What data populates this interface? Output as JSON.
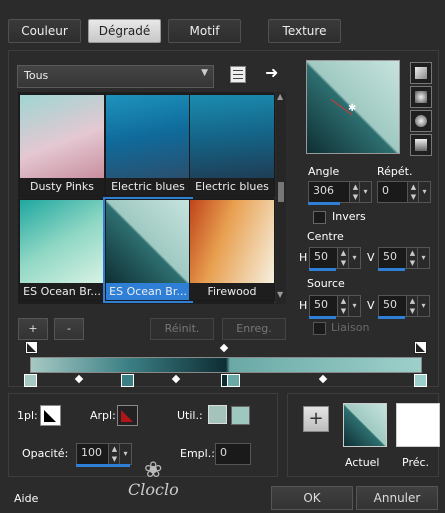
{
  "tabs": [
    {
      "label": "Couleur",
      "active": false
    },
    {
      "label": "Dégradé",
      "active": true
    },
    {
      "label": "Motif",
      "active": false
    },
    {
      "label": "Texture",
      "active": false
    }
  ],
  "category_dropdown": {
    "value": "Tous"
  },
  "gradients": [
    {
      "label": "Dusty Pinks",
      "colors": [
        "#9ed6d2",
        "#e4c8d2",
        "#c98f9f"
      ]
    },
    {
      "label": "Electric blues",
      "colors": [
        "#1e93bd",
        "#0f6a9a",
        "#2b4f6e"
      ]
    },
    {
      "label": "Electric blues",
      "colors": [
        "#1b8cb0",
        "#146487",
        "#1f3d55"
      ]
    },
    {
      "label": "ES Ocean Br...",
      "colors": [
        "#1fa7a0",
        "#8fd7c4",
        "#d8f2e4"
      ]
    },
    {
      "label": "ES Ocean Br...",
      "colors": [
        "#9fc9c2",
        "#2e6f70",
        "#0e2f34"
      ],
      "selected": true
    },
    {
      "label": "Firewood",
      "colors": [
        "#c0441a",
        "#e8a050",
        "#f6f0e0"
      ]
    }
  ],
  "buttons": {
    "add": "+",
    "remove": "-",
    "reset": "Réinit.",
    "save": "Enreg."
  },
  "angle": {
    "label": "Angle",
    "value": "306"
  },
  "repeat": {
    "label": "Répét.",
    "value": "0"
  },
  "invert": {
    "label": "Invers",
    "checked": false
  },
  "center": {
    "label": "Centre",
    "h_label": "H",
    "h": "50",
    "v_label": "V",
    "v": "50"
  },
  "source": {
    "label": "Source",
    "h_label": "H",
    "h": "50",
    "v_label": "V",
    "v": "50"
  },
  "link": {
    "label": "Liaison",
    "checked": false
  },
  "stop_row": {
    "one_pl_label": "1pl:",
    "arpl_label": "Arpl:",
    "util_label": "Util.:",
    "util_colors": [
      "#a3c3bb",
      "#9ec7bf"
    ]
  },
  "opacity": {
    "label": "Opacité:",
    "value": "100"
  },
  "empl": {
    "label": "Empl.:",
    "value": "0"
  },
  "swatches": {
    "current": "Actuel",
    "previous": "Préc."
  },
  "footer": {
    "help": "Aide",
    "ok": "OK",
    "cancel": "Annuler"
  },
  "watermark": "Cloclo",
  "colors": {
    "accent": "#2f7fd6",
    "gradient_stops": [
      "#a7c9c4",
      "#3b7f84",
      "#0d2d33",
      "#6aa9a6",
      "#9ed0cb"
    ]
  }
}
